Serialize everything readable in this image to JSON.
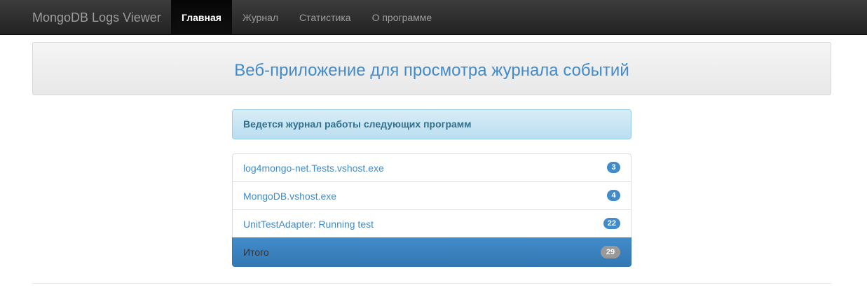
{
  "navbar": {
    "brand": "MongoDB Logs Viewer",
    "items": [
      {
        "label": "Главная",
        "active": true
      },
      {
        "label": "Журнал",
        "active": false
      },
      {
        "label": "Статистика",
        "active": false
      },
      {
        "label": "О программе",
        "active": false
      }
    ]
  },
  "hero": {
    "title": "Веб-приложение для просмотра журнала событий"
  },
  "info": {
    "text": "Ведется журнал работы следующих программ"
  },
  "programs": [
    {
      "name": "log4mongo-net.Tests.vshost.exe",
      "count": "3"
    },
    {
      "name": "MongoDB.vshost.exe",
      "count": "4"
    },
    {
      "name": "UnitTestAdapter: Running test",
      "count": "22"
    }
  ],
  "total": {
    "label": "Итого",
    "count": "29"
  },
  "colors": {
    "accent": "#428bca",
    "navbar": "#222222",
    "info_text": "#31708f"
  }
}
